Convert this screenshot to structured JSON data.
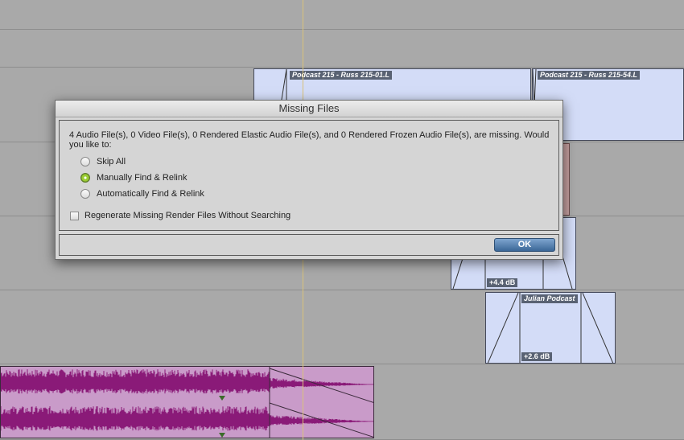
{
  "timeline": {
    "clips": [
      {
        "name": "Podcast 215 - Russ 215-01.L"
      },
      {
        "name": "Podcast 215 - Russ 215-54.L"
      },
      {
        "name": "Julian Podcast",
        "gain": "+2.6 dB"
      }
    ],
    "partial_clip": {
      "gain": "+4.4 dB"
    }
  },
  "dialog": {
    "title": "Missing Files",
    "message": "4 Audio File(s), 0 Video File(s), 0 Rendered Elastic Audio File(s), and 0 Rendered Frozen Audio File(s), are missing. Would you like to:",
    "options": [
      {
        "label": "Skip All",
        "selected": false
      },
      {
        "label": "Manually Find & Relink",
        "selected": true
      },
      {
        "label": "Automatically Find & Relink",
        "selected": false
      }
    ],
    "checkbox": {
      "label": "Regenerate Missing Render Files Without Searching",
      "checked": false
    },
    "ok_label": "OK"
  },
  "colors": {
    "accent": "#9acd32",
    "waveform": "#8a1a78",
    "clip_fill": "#d3dcf7"
  }
}
